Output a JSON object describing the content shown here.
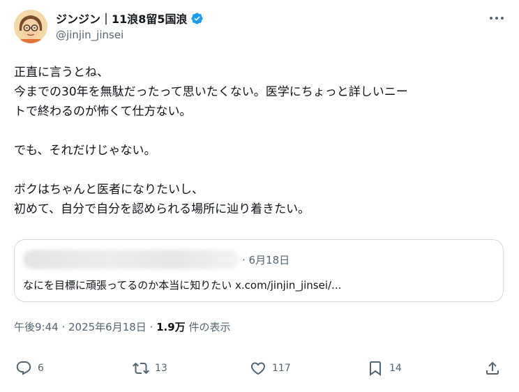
{
  "author": {
    "display_name": "ジンジン｜11浪8留5国浪",
    "handle": "@jinjin_jinsei",
    "verified": true,
    "avatar_icon": "cartoon-face-avatar"
  },
  "tweet": {
    "text": "正直に言うとね、\n今までの30年を無駄だったって思いたくない。医学にちょっと詳しいニー\nトで終わるのが怖くて仕方ない。\n\nでも、それだけじゃない。\n\nボクはちゃんと医者になりたいし、\n初めて、自分で自分を認められる場所に辿り着きたい。"
  },
  "quote": {
    "date": "· 6月18日",
    "text": "なにを目標に頑張ってるのか本当に知りたい x.com/jinjin_jinsei/..."
  },
  "meta": {
    "time": "午後9:44 · 2025年6月18日 · ",
    "views": "1.9万",
    "views_label": " 件の表示"
  },
  "actions": {
    "reply_count": "6",
    "retweet_count": "13",
    "like_count": "117",
    "bookmark_count": "14"
  },
  "colors": {
    "text": "#0f1419",
    "secondary": "#536471",
    "verified": "#1d9bf0",
    "border": "#cfd9de"
  }
}
